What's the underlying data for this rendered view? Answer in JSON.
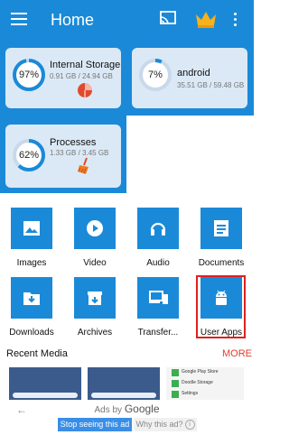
{
  "header": {
    "title": "Home",
    "menu_icon": "hamburger-menu-icon",
    "cast_icon": "cast-icon",
    "crown_icon": "crown-icon",
    "more_icon": "more-vert-icon"
  },
  "storage": [
    {
      "name": "Internal Storage",
      "percent": "97%",
      "percent_value": 0.97,
      "detail": "0.91 GB / 24.94 GB",
      "icon": "pie-chart-icon"
    },
    {
      "name": "android",
      "percent": "7%",
      "percent_value": 0.07,
      "detail": "35.51 GB / 59.48 GB"
    },
    {
      "name": "Processes",
      "percent": "62%",
      "percent_value": 0.62,
      "detail": "1.33 GB / 3.45 GB",
      "icon": "broom-icon"
    }
  ],
  "categories": [
    {
      "label": "Images",
      "icon": "image-icon"
    },
    {
      "label": "Video",
      "icon": "play-icon"
    },
    {
      "label": "Audio",
      "icon": "headphones-icon"
    },
    {
      "label": "Documents",
      "icon": "document-icon"
    },
    {
      "label": "Downloads",
      "icon": "download-icon"
    },
    {
      "label": "Archives",
      "icon": "archive-icon"
    },
    {
      "label": "Transfer...",
      "icon": "transfer-devices-icon"
    },
    {
      "label": "User Apps",
      "icon": "android-icon"
    }
  ],
  "recent": {
    "title": "Recent Media",
    "more": "MORE",
    "thumb3_lines": [
      "Google Play Store",
      "Doodle Storage",
      "Settings"
    ]
  },
  "ads": {
    "ads_by": "Ads by",
    "google": "Google",
    "stop": "Stop seeing this ad",
    "why": "Why this ad?",
    "back_icon": "arrow-left-icon"
  },
  "colors": {
    "primary": "#1a8ad8",
    "card": "#dbe9f6",
    "accent_orange": "#f29d14",
    "more_red": "#e23b2b",
    "highlight_red": "#e02020"
  }
}
